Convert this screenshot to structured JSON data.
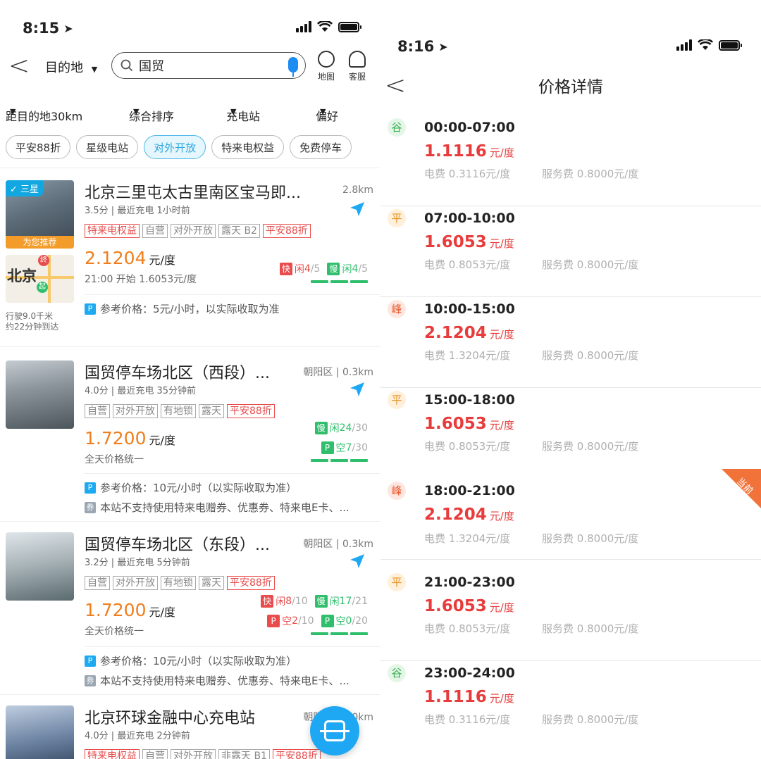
{
  "left": {
    "status_time": "8:15",
    "back": "<",
    "dest_label": "目的地",
    "search_value": "国贸",
    "map_label": "地图",
    "service_label": "客服",
    "filters": [
      "距目的地30km",
      "综合排序",
      "充电站",
      "偏好"
    ],
    "chips": [
      "平安88折",
      "星级电站",
      "对外开放",
      "特来电权益",
      "免费停车"
    ],
    "stations": [
      {
        "title": "北京三里屯太古里南区宝马即...",
        "dist": "2.8km",
        "meta": "3.5分 | 最近充电 1小时前",
        "tags": [
          "特来电权益",
          "自营",
          "对外开放",
          "露天 B2",
          "平安88折"
        ],
        "price": "2.1204",
        "unit": "元/度",
        "price_sub": "21:00 开始 1.6053元/度",
        "star_tag": "三星",
        "rec_tag": "为您推荐",
        "map_city": "北京",
        "drive_1": "行驶9.0千米",
        "drive_2": "约22分钟到达",
        "fast_label": "快",
        "fast_state": "闲",
        "fast_cnt": "4",
        "fast_tot": "/5",
        "slow_label": "慢",
        "slow_state": "闲",
        "slow_cnt": "4",
        "slow_tot": "/5",
        "info": "参考价格：5元/小时，以实际收取为准"
      },
      {
        "title": "国贸停车场北区（西段）...",
        "dist": "朝阳区 | 0.3km",
        "meta": "4.0分 | 最近充电 35分钟前",
        "tags": [
          "自营",
          "对外开放",
          "有地锁",
          "露天",
          "平安88折"
        ],
        "price": "1.7200",
        "unit": "元/度",
        "price_sub": "全天价格统一",
        "slow_label": "慢",
        "slow_state": "闲",
        "slow_cnt": "24",
        "slow_tot": "/30",
        "park_label": "P",
        "park_state": "空",
        "park_cnt": "7",
        "park_tot": "/30",
        "info": "参考价格：10元/小时（以实际收取为准）",
        "coupon": "本站不支持使用特来电赠券、优惠券、特来电E卡、..."
      },
      {
        "title": "国贸停车场北区（东段）...",
        "dist": "朝阳区 | 0.3km",
        "meta": "3.2分 | 最近充电 5分钟前",
        "tags": [
          "自营",
          "对外开放",
          "有地锁",
          "露天",
          "平安88折"
        ],
        "price": "1.7200",
        "unit": "元/度",
        "price_sub": "全天价格统一",
        "fast_label": "快",
        "fast_state": "闲",
        "fast_cnt": "8",
        "fast_tot": "/10",
        "slow_label": "慢",
        "slow_state": "闲",
        "slow_cnt": "17",
        "slow_tot": "/21",
        "park1_label": "P",
        "park1_state": "空",
        "park1_cnt": "2",
        "park1_tot": "/10",
        "park2_label": "P",
        "park2_state": "空",
        "park2_cnt": "0",
        "park2_tot": "/20",
        "info": "参考价格：10元/小时（以实际收取为准）",
        "coupon": "本站不支持使用特来电赠券、优惠券、特来电E卡、..."
      },
      {
        "title": "北京环球金融中心充电站",
        "dist": "朝阳区 | 0.0km",
        "meta": "4.0分 | 最近充电 2分钟前",
        "tags": [
          "特来电权益",
          "自营",
          "对外开放",
          "非露天 B1",
          "平安88折"
        ]
      }
    ],
    "info_icon": "P",
    "coupon_icon": "券"
  },
  "right": {
    "status_time": "8:16",
    "back": "<",
    "title": "价格详情",
    "fee_label": "电费",
    "service_label": "服务费",
    "current_label": "当前",
    "slots": [
      {
        "badge": "谷",
        "kind": "gu",
        "time": "00:00-07:00",
        "price": "1.1116",
        "unit": "元/度",
        "fee": "0.3116元/度",
        "service": "0.8000元/度"
      },
      {
        "badge": "平",
        "kind": "ping",
        "time": "07:00-10:00",
        "price": "1.6053",
        "unit": "元/度",
        "fee": "0.8053元/度",
        "service": "0.8000元/度"
      },
      {
        "badge": "峰",
        "kind": "feng",
        "time": "10:00-15:00",
        "price": "2.1204",
        "unit": "元/度",
        "fee": "1.3204元/度",
        "service": "0.8000元/度"
      },
      {
        "badge": "平",
        "kind": "ping",
        "time": "15:00-18:00",
        "price": "1.6053",
        "unit": "元/度",
        "fee": "0.8053元/度",
        "service": "0.8000元/度"
      },
      {
        "badge": "峰",
        "kind": "feng",
        "time": "18:00-21:00",
        "price": "2.1204",
        "unit": "元/度",
        "fee": "1.3204元/度",
        "service": "0.8000元/度"
      },
      {
        "badge": "平",
        "kind": "ping",
        "time": "21:00-23:00",
        "price": "1.6053",
        "unit": "元/度",
        "fee": "0.8053元/度",
        "service": "0.8000元/度"
      },
      {
        "badge": "谷",
        "kind": "gu",
        "time": "23:00-24:00",
        "price": "1.1116",
        "unit": "元/度",
        "fee": "0.3116元/度",
        "service": "0.8000元/度"
      }
    ]
  },
  "colors": {
    "accent": "#1ea7f2",
    "price_orange": "#f07e1e",
    "price_red": "#e83b3b",
    "green": "#2fbf6c",
    "red": "#e84c4c"
  }
}
